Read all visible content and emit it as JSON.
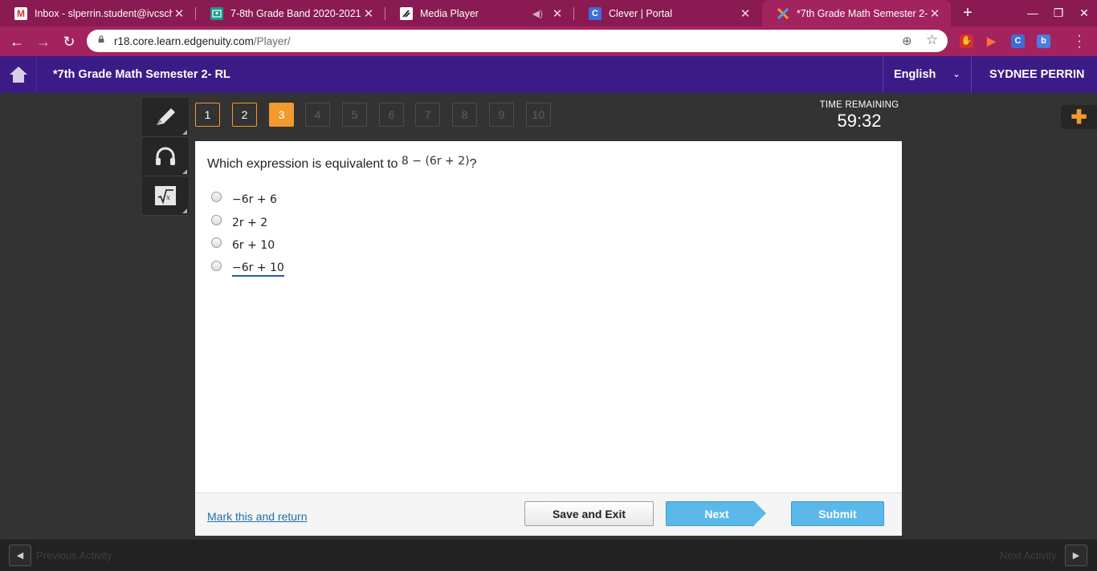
{
  "browser": {
    "tabs": [
      {
        "title": "Inbox - slperrin.student@ivcsch",
        "icon": "gmail-icon",
        "color": "#d93025",
        "glyph": "M",
        "active": false
      },
      {
        "title": "7-8th Grade Band 2020-2021",
        "icon": "classroom-icon",
        "color": "#1a9c8f",
        "glyph": "",
        "active": false
      },
      {
        "title": "Media Player",
        "icon": "media-player-icon",
        "color": "#ffffff",
        "glyph": "",
        "active": false
      },
      {
        "title": "Clever | Portal",
        "icon": "clever-icon",
        "color": "#3d6ed8",
        "glyph": "C",
        "active": false
      },
      {
        "title": "*7th Grade Math Semester 2- RL",
        "icon": "edgenuity-icon",
        "color": "#f29a2e",
        "glyph": "",
        "active": true
      }
    ],
    "url_host": "r18.core.learn.edgenuity.com",
    "url_path": "/Player/",
    "extensions": [
      "adblock-icon",
      "screencastify-icon",
      "clever-extension-icon",
      "b-extension-icon"
    ]
  },
  "header": {
    "course_title": "*7th Grade Math Semester 2- RL",
    "language": "English",
    "user_name": "SYDNEE PERRIN"
  },
  "questions": {
    "numbers": [
      "1",
      "2",
      "3",
      "4",
      "5",
      "6",
      "7",
      "8",
      "9",
      "10"
    ],
    "current": 3,
    "completed": [
      1,
      2
    ]
  },
  "timer": {
    "label": "TIME REMAINING",
    "value": "59:32"
  },
  "question": {
    "prompt": "Which expression is equivalent to ",
    "expression": "8 − (6r + 2)",
    "suffix": "?",
    "options": [
      "−6r + 6",
      "2r + 2",
      "6r + 10",
      "−6r + 10"
    ],
    "highlighted_option": 3
  },
  "footer": {
    "mark_return": "Mark this and return",
    "save_exit": "Save and Exit",
    "next": "Next",
    "submit": "Submit"
  },
  "activity_nav": {
    "previous": "Previous Activity",
    "next": "Next Activity"
  },
  "colors": {
    "browser_frame": "#a3235f",
    "header_purple": "#3d1b87",
    "accent_orange": "#f29a2e",
    "button_blue": "#5bb8ea"
  }
}
